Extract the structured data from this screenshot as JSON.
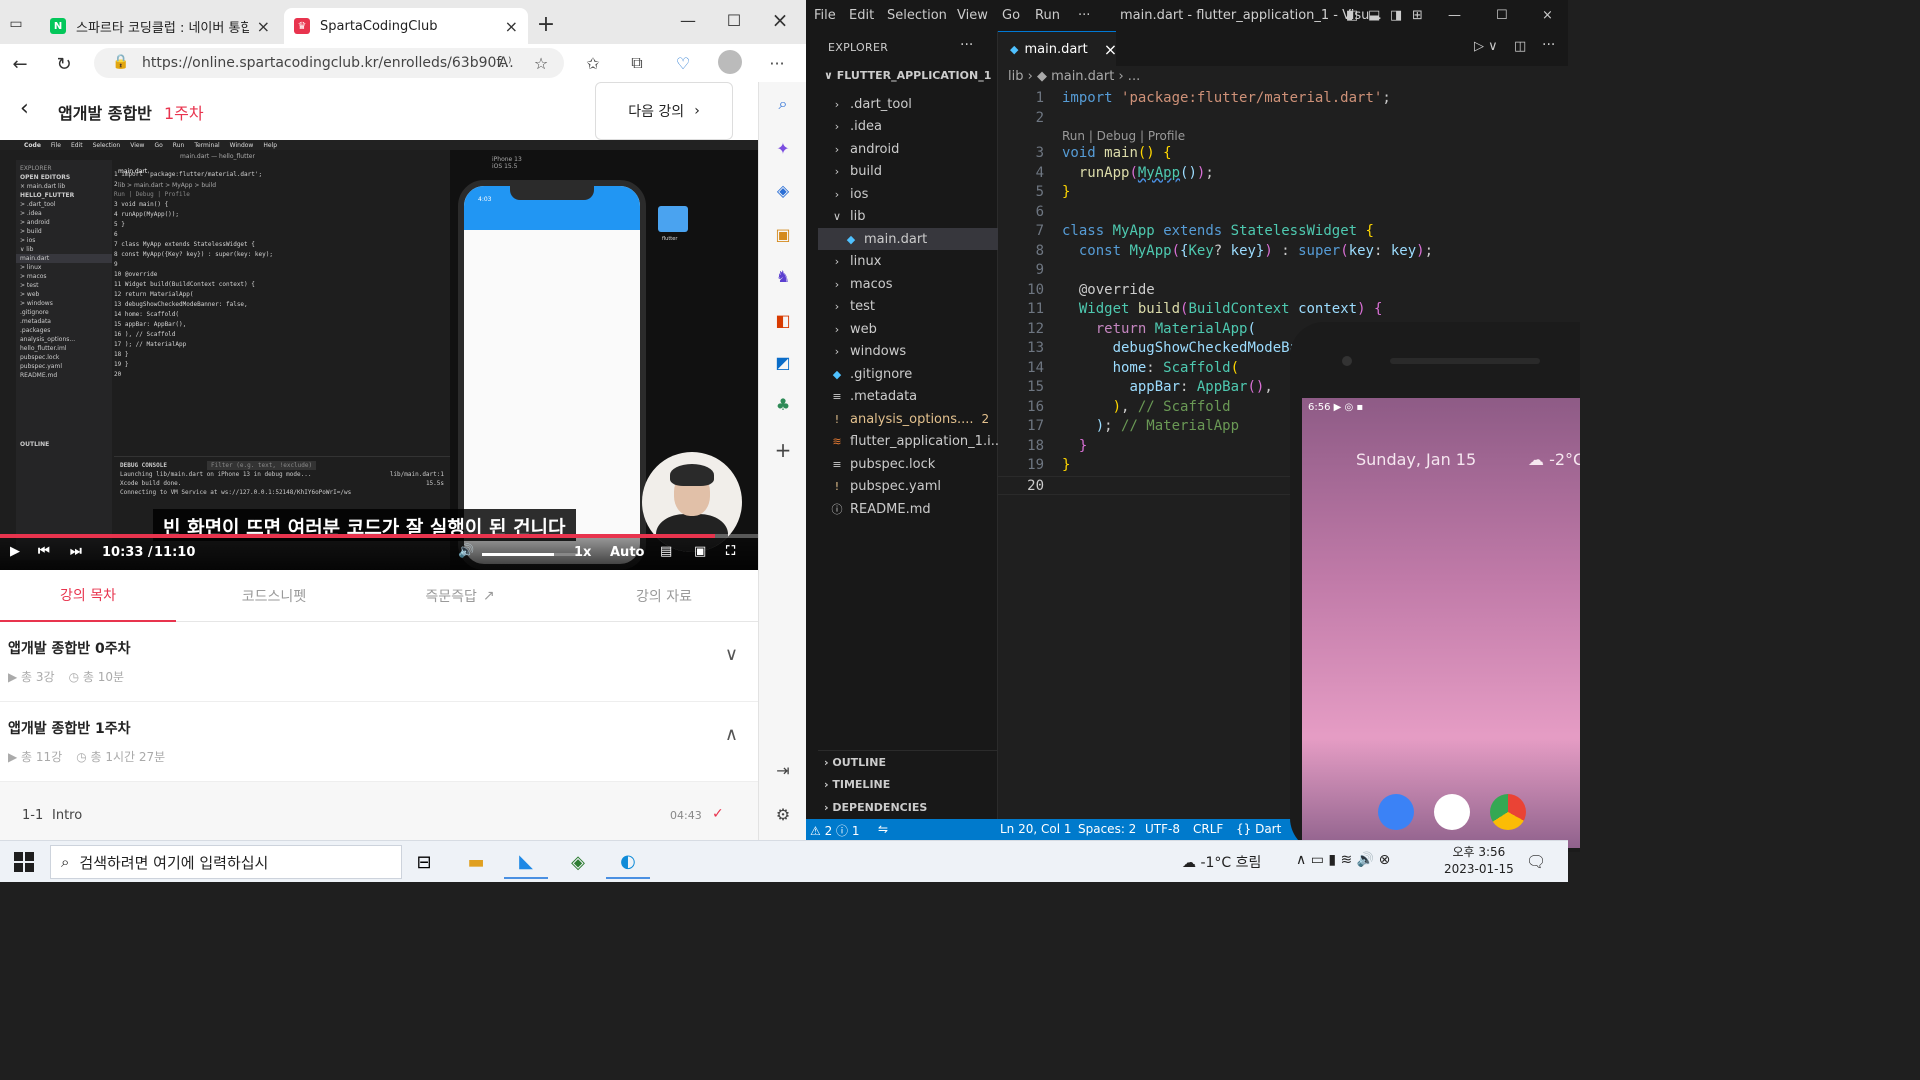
{
  "browser": {
    "tabs": [
      {
        "title": "스파르타 코딩클럽 : 네이버 통합",
        "favicon": "N",
        "favicon_color": "#03c75a"
      },
      {
        "title": "SpartaCodingClub",
        "favicon": "♛",
        "favicon_color": "#e8344e"
      }
    ],
    "url": "https://online.spartacodingclub.kr/enrolleds/63b90f...",
    "read_aloud": "A⁾"
  },
  "course": {
    "title": "앱개발 종합반",
    "week": "1주차",
    "next_label": "다음 강의"
  },
  "video": {
    "mac_menu": [
      "Code",
      "File",
      "Edit",
      "Selection",
      "View",
      "Go",
      "Run",
      "Terminal",
      "Window",
      "Help"
    ],
    "mac_title": "main.dart — hello_flutter",
    "mac_sidebar": [
      "EXPLORER",
      "OPEN EDITORS",
      "× main.dart lib",
      "HELLO_FLUTTER",
      "> .dart_tool",
      "> .idea",
      "> android",
      "> build",
      "> ios",
      "∨ lib",
      "   main.dart",
      "> linux",
      "> macos",
      "> test",
      "> web",
      "> windows",
      ".gitignore",
      ".metadata",
      ".packages",
      "analysis_options...",
      "hello_flutter.iml",
      "pubspec.lock",
      "pubspec.yaml",
      "README.md"
    ],
    "mac_outline": "OUTLINE",
    "mac_tab": "main.dart",
    "mac_breadcrumb": "lib > main.dart > MyApp > build",
    "mac_code": [
      "1  import 'package:flutter/material.dart';",
      "2",
      "   Run | Debug | Profile",
      "3  void main() {",
      "4    runApp(MyApp());",
      "5  }",
      "6",
      "7  class MyApp extends StatelessWidget {",
      "8    const MyApp({Key? key}) : super(key: key);",
      "9",
      "10   @override",
      "11   Widget build(BuildContext context) {",
      "12     return MaterialApp(",
      "13       debugShowCheckedModeBanner: false,",
      "14       home: Scaffold(",
      "15         appBar: AppBar(),",
      "16       ), // Scaffold",
      "17     ); // MaterialApp",
      "18   }",
      "19 }",
      "20"
    ],
    "mac_console_title": "DEBUG CONSOLE",
    "mac_console_filter": "Filter (e.g. text, !exclude)",
    "mac_console_link": "lib/main.dart:1",
    "mac_console_time": "15.5s",
    "mac_console": [
      "Launching lib/main.dart on iPhone 13 in debug mode...",
      "Xcode build done.",
      "Connecting to VM Service at ws://127.0.0.1:52148/KhIY6oPoWrI=/ws"
    ],
    "simulator_title": "iPhone 13",
    "simulator_os": "iOS 15.5",
    "iphone_time": "4:03",
    "folder_label": "flutter",
    "subtitle": "빈 화면이 뜨면 여러분 코드가 잘 실행이 된 건니다",
    "time_current": "10:33 /",
    "time_total": "11:10",
    "progress": 0.943,
    "volume": 0.75,
    "speed": "1x",
    "quality": "Auto"
  },
  "lesson_tabs": [
    "강의 목차",
    "코드스니펫",
    "즉문즉답",
    "강의 자료"
  ],
  "weeks": [
    {
      "title": "앱개발 종합반 0주차",
      "lessons": "총 3강",
      "duration": "총 10분",
      "chevron": "∨"
    },
    {
      "title": "앱개발 종합반 1주차",
      "lessons": "총 11강",
      "duration": "총 1시간 27분",
      "chevron": "∧"
    }
  ],
  "lesson": {
    "num": "1-1",
    "name": "Intro",
    "duration": "04:43",
    "check": "✓"
  },
  "vscode": {
    "menu": [
      "File",
      "Edit",
      "Selection",
      "View",
      "Go",
      "Run",
      "···"
    ],
    "title": "main.dart - flutter_application_1 - Visu...",
    "explorer_title": "EXPLORER",
    "explorer_dots": "···",
    "project": "FLUTTER_APPLICATION_1",
    "tree": [
      {
        "icon": "›",
        "name": ".dart_tool"
      },
      {
        "icon": "›",
        "name": ".idea"
      },
      {
        "icon": "›",
        "name": "android"
      },
      {
        "icon": "›",
        "name": "build"
      },
      {
        "icon": "›",
        "name": "ios"
      },
      {
        "icon": "∨",
        "name": "lib"
      },
      {
        "icon": "◆",
        "name": "main.dart"
      },
      {
        "icon": "›",
        "name": "linux"
      },
      {
        "icon": "›",
        "name": "macos"
      },
      {
        "icon": "›",
        "name": "test"
      },
      {
        "icon": "›",
        "name": "web"
      },
      {
        "icon": "›",
        "name": "windows"
      },
      {
        "icon": "◆",
        "name": ".gitignore"
      },
      {
        "icon": "≡",
        "name": ".metadata"
      },
      {
        "icon": "!",
        "name": "analysis_options....",
        "badge": "2"
      },
      {
        "icon": "≋",
        "name": "flutter_application_1.i..."
      },
      {
        "icon": "≡",
        "name": "pubspec.lock"
      },
      {
        "icon": "!",
        "name": "pubspec.yaml"
      },
      {
        "icon": "ⓘ",
        "name": "README.md"
      }
    ],
    "panels": [
      "OUTLINE",
      "TIMELINE",
      "DEPENDENCIES"
    ],
    "tab": "main.dart",
    "tab_close": "×",
    "breadcrumb": "lib  ›  ◆ main.dart  ›  ...",
    "codelens": "Run | Debug | Profile",
    "line_numbers": [
      "1",
      "2",
      "3",
      "4",
      "5",
      "6",
      "7",
      "8",
      "9",
      "10",
      "11",
      "12",
      "13",
      "14",
      "15",
      "16",
      "17",
      "18",
      "19",
      "20"
    ],
    "statusbar": {
      "problems": "⚠ 2 ⓘ 1",
      "position": "Ln 20, Col 1",
      "spaces": "Spaces: 2",
      "encoding": "UTF-8",
      "eol": "CRLF",
      "language": "{} Dart"
    }
  },
  "android": {
    "status_time": "6:56",
    "date": "Sunday, Jan 15",
    "temp": "☁ -2°C"
  },
  "taskbar": {
    "search_placeholder": "검색하려면 여기에 입력하십시",
    "weather": "☁ -1°C 흐림",
    "time": "오후 3:56",
    "date": "2023-01-15"
  }
}
